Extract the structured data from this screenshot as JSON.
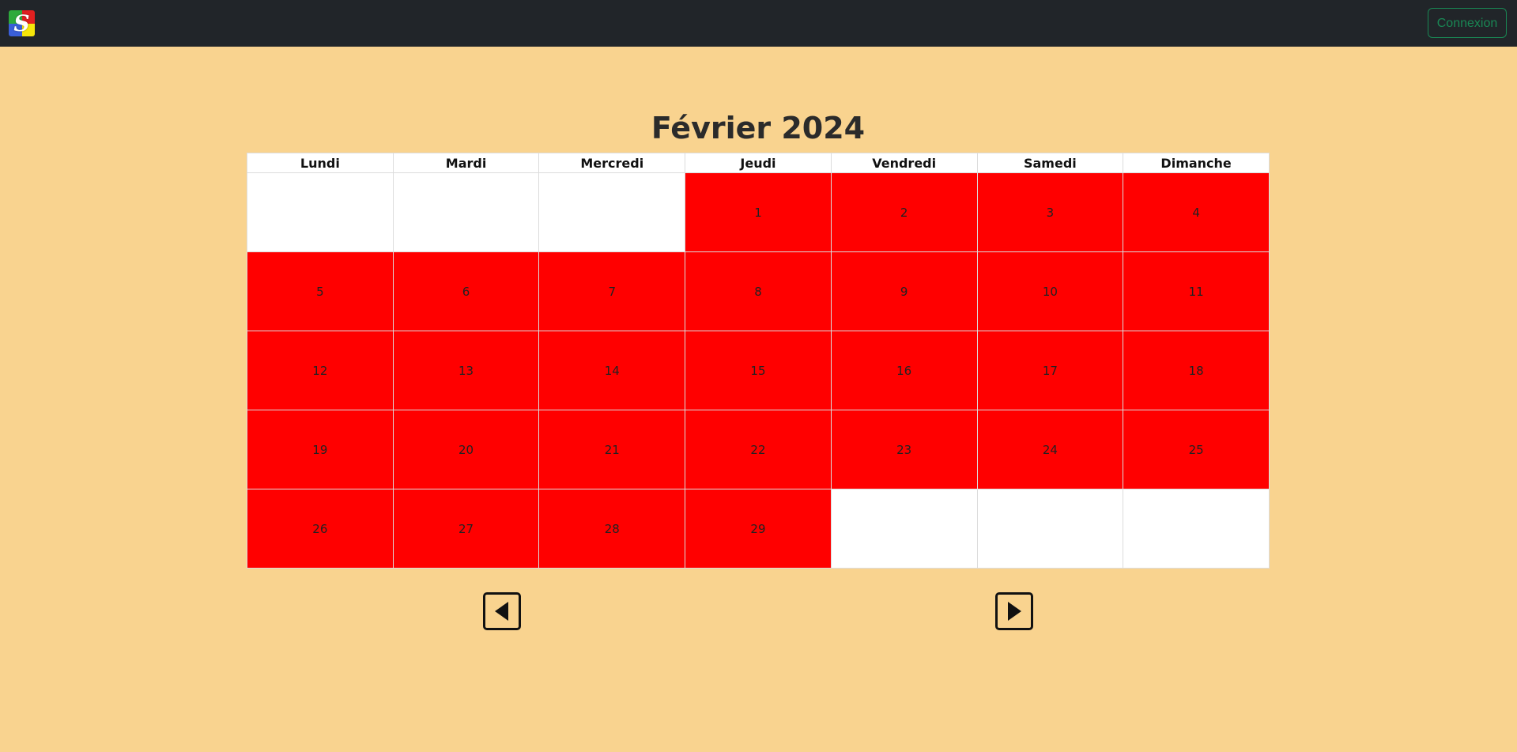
{
  "navbar": {
    "logo_letter": "S",
    "login_label": "Connexion"
  },
  "calendar": {
    "title": "Février 2024",
    "weekdays": [
      "Lundi",
      "Mardi",
      "Mercredi",
      "Jeudi",
      "Vendredi",
      "Samedi",
      "Dimanche"
    ],
    "busy_color": "#ff0000",
    "weeks": [
      [
        "",
        "",
        "",
        "1",
        "2",
        "3",
        "4"
      ],
      [
        "5",
        "6",
        "7",
        "8",
        "9",
        "10",
        "11"
      ],
      [
        "12",
        "13",
        "14",
        "15",
        "16",
        "17",
        "18"
      ],
      [
        "19",
        "20",
        "21",
        "22",
        "23",
        "24",
        "25"
      ],
      [
        "26",
        "27",
        "28",
        "29",
        "",
        "",
        ""
      ]
    ]
  },
  "navigation": {
    "prev_icon": "triangle-left-icon",
    "next_icon": "triangle-right-icon"
  }
}
